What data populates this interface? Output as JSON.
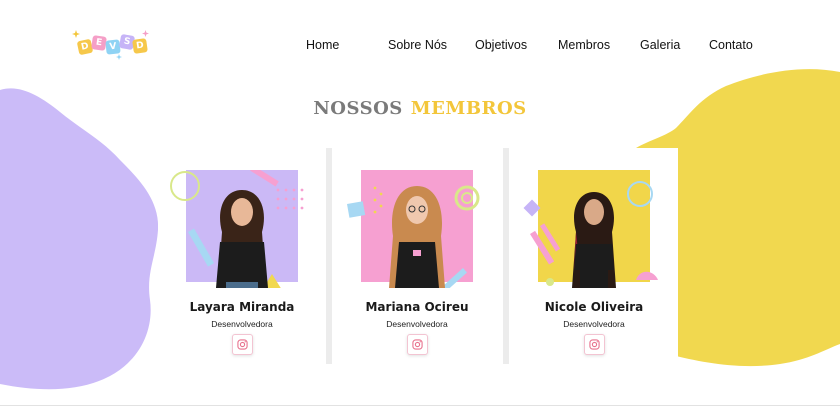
{
  "brand": {
    "logo_letters": [
      "D",
      "E",
      "V",
      "S",
      "D"
    ],
    "logo_colors": [
      "#f6c84b",
      "#f59fc7",
      "#8fd3f4",
      "#c6b4f7",
      "#f6c84b"
    ]
  },
  "nav": {
    "items": [
      "Home",
      "Sobre Nós",
      "Objetivos",
      "Membros",
      "Galeria",
      "Contato"
    ]
  },
  "section": {
    "title_part1": "NOSSOS",
    "title_part2": "MEMBROS"
  },
  "members": [
    {
      "name": "Layara Miranda",
      "role": "Desenvolvedora",
      "social_icon": "instagram-icon",
      "photo_bg": "#cbb9f6"
    },
    {
      "name": "Mariana Ocireu",
      "role": "Desenvolvedora",
      "social_icon": "instagram-icon",
      "photo_bg": "#f6a0d1"
    },
    {
      "name": "Nicole Oliveira",
      "role": "Desenvolvedora",
      "social_icon": "instagram-icon",
      "photo_bg": "#f1d64a"
    }
  ],
  "colors": {
    "purple_blob": "#cbbbf8",
    "yellow_blob": "#f1d84f",
    "accent_yellow": "#f3c63a",
    "accent_pink": "#f9a3c6",
    "accent_blue": "#a7d8f3"
  }
}
